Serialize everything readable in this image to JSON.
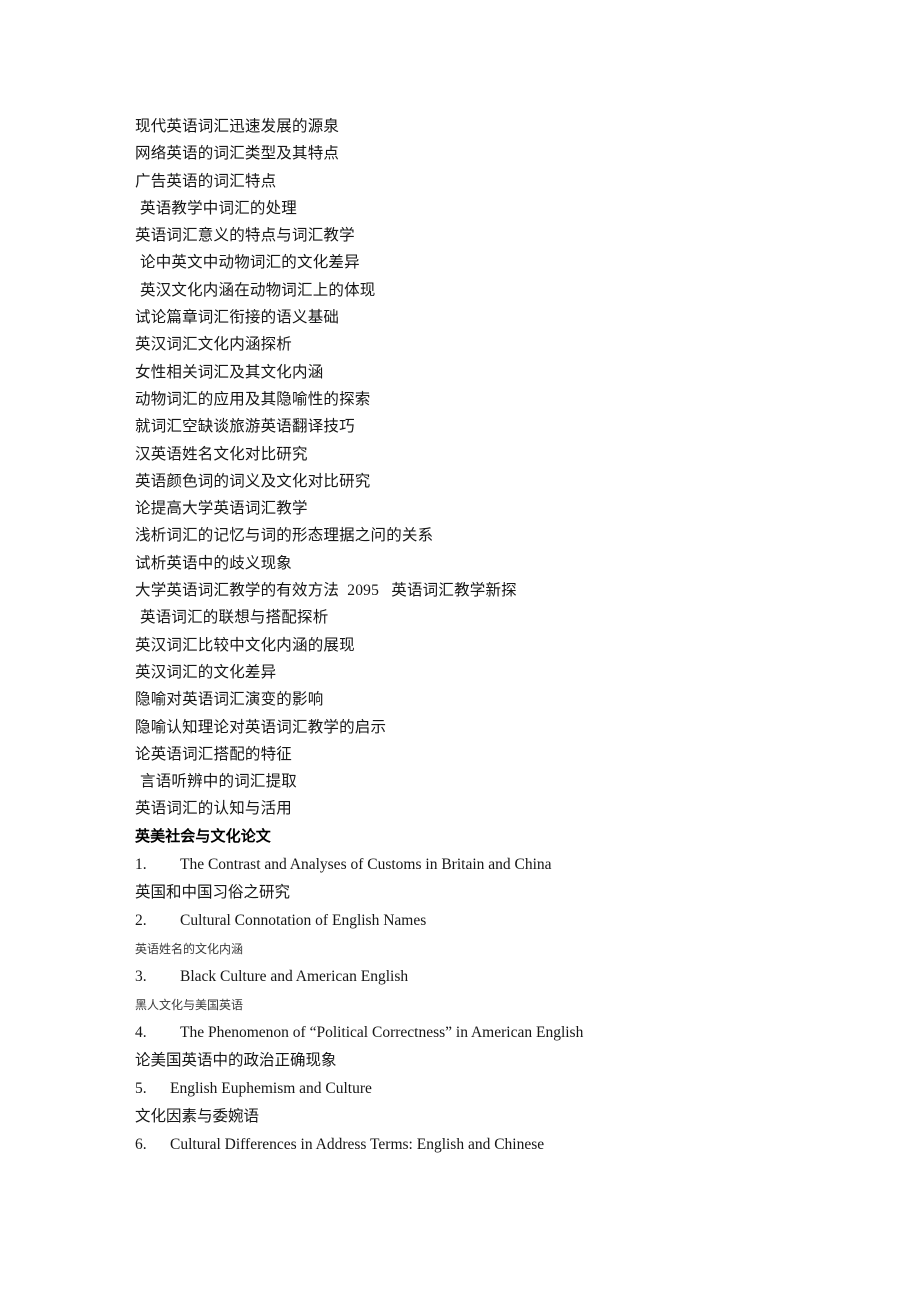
{
  "document": {
    "vocabulary_topics": [
      {
        "text": "现代英语词汇迅速发展的源泉",
        "indent": false
      },
      {
        "text": "网络英语的词汇类型及其特点",
        "indent": false
      },
      {
        "text": "广告英语的词汇特点",
        "indent": false
      },
      {
        "text": "英语教学中词汇的处理",
        "indent": true
      },
      {
        "text": "英语词汇意义的特点与词汇教学",
        "indent": false
      },
      {
        "text": "论中英文中动物词汇的文化差异",
        "indent": true
      },
      {
        "text": "英汉文化内涵在动物词汇上的体现",
        "indent": true
      },
      {
        "text": "试论篇章词汇衔接的语义基础",
        "indent": false
      },
      {
        "text": "英汉词汇文化内涵探析",
        "indent": false
      },
      {
        "text": "女性相关词汇及其文化内涵",
        "indent": false
      },
      {
        "text": "动物词汇的应用及其隐喻性的探索",
        "indent": false
      },
      {
        "text": "就词汇空缺谈旅游英语翻译技巧",
        "indent": false
      },
      {
        "text": "汉英语姓名文化对比研究",
        "indent": false
      },
      {
        "text": "英语颜色词的词义及文化对比研究",
        "indent": false
      },
      {
        "text": "论提高大学英语词汇教学",
        "indent": false
      },
      {
        "text": "浅析词汇的记忆与词的形态理据之问的关系",
        "indent": false
      },
      {
        "text": "试析英语中的歧义现象",
        "indent": false
      },
      {
        "text": "大学英语词汇教学的有效方法  2095   英语词汇教学新探",
        "indent": false
      },
      {
        "text": "英语词汇的联想与搭配探析",
        "indent": true
      },
      {
        "text": "英汉词汇比较中文化内涵的展现",
        "indent": false
      },
      {
        "text": "英汉词汇的文化差异",
        "indent": false
      },
      {
        "text": "隐喻对英语词汇演变的影响",
        "indent": false
      },
      {
        "text": "隐喻认知理论对英语词汇教学的启示",
        "indent": false
      },
      {
        "text": "论英语词汇搭配的特征",
        "indent": false
      },
      {
        "text": "言语听辨中的词汇提取",
        "indent": true
      },
      {
        "text": "英语词汇的认知与活用",
        "indent": false
      }
    ],
    "section": {
      "heading": "英美社会与文化论文",
      "entries": [
        {
          "number": "1.",
          "gap": "wide",
          "title_en": "The Contrast and Analyses of Customs in Britain and China",
          "subtitle_cn": "英国和中国习俗之研究",
          "subtitle_small": false
        },
        {
          "number": "2.",
          "gap": "wide",
          "title_en": "Cultural Connotation of English Names",
          "subtitle_cn": "英语姓名的文化内涵",
          "subtitle_small": true
        },
        {
          "number": "3.",
          "gap": "wide",
          "title_en": "Black Culture and American English",
          "subtitle_cn": "黑人文化与美国英语",
          "subtitle_small": true
        },
        {
          "number": "4.",
          "gap": "wide",
          "title_en": "The Phenomenon of “Political Correctness” in American English",
          "subtitle_cn": "论美国英语中的政治正确现象",
          "subtitle_small": false
        },
        {
          "number": "5.",
          "gap": "narrow",
          "title_en": "English Euphemism and Culture",
          "subtitle_cn": "文化因素与委婉语",
          "subtitle_small": false
        },
        {
          "number": "6.",
          "gap": "narrow",
          "title_en": "Cultural Differences in Address Terms: English and Chinese",
          "subtitle_cn": "",
          "subtitle_small": false
        }
      ]
    }
  }
}
